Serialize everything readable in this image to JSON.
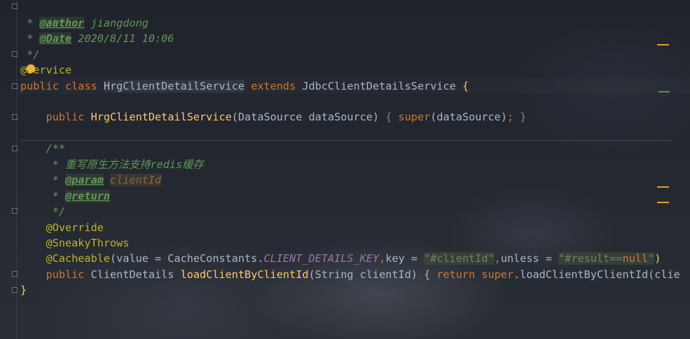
{
  "code": {
    "l1": "/**",
    "l2_star": " * ",
    "l2_tag": "@author",
    "l2_val": " jiangdong",
    "l3_star": " * ",
    "l3_tag": "@Date",
    "l3_val": " 2020/8/11 10:06",
    "l4": " */",
    "l5": "@Service",
    "l6_public": "public",
    "l6_class": " class ",
    "l6_name": "HrgClientDetailService",
    "l6_extends": " extends ",
    "l6_super": "JdbcClientDetailsService ",
    "l6_brace": "{",
    "l7_public": "    public ",
    "l7_name": "HrgClientDetailService",
    "l7_args": "(DataSource dataSource) ",
    "l7_open": "{ ",
    "l7_super": "super",
    "l7_call": "(dataSource)",
    "l7_semi": "; ",
    "l7_close": "}",
    "l8": "    /**",
    "l9": "     * 重写原生方法支持redis缓存",
    "l10_star": "     * ",
    "l10_tag": "@param",
    "l10_sp": " ",
    "l10_name": "clientId",
    "l11_star": "     * ",
    "l11_tag": "@return",
    "l12": "     */",
    "l13": "    @Override",
    "l14": "    @SneakyThrows",
    "l15_ann": "    @Cacheable",
    "l15_a": "(value = CacheConstants.",
    "l15_const": "CLIENT_DETAILS_KEY",
    "l15_comma": ",",
    "l15_b": "key = ",
    "l15_str1": "\"#clientId\"",
    "l15_comma2": ",",
    "l15_c": "unless = ",
    "l15_str2a": "\"#result==",
    "l15_null": "null",
    "l15_str2b": "\"",
    "l15_end": ")",
    "l16_public": "    public ",
    "l16_type": "ClientDetails ",
    "l16_name": "loadClientByClientId",
    "l16_args": "(String clientId) { ",
    "l16_return": "return ",
    "l16_super": "super",
    "l16_rest": ".loadClientByClientId(clie",
    "l17": "}"
  },
  "colors": {
    "keyword": "#cc7832",
    "function": "#ffc66d",
    "annotation": "#bbb529",
    "comment": "#629755",
    "constant": "#9876aa",
    "string": "#6a8759",
    "warning_marker": "#e0a020"
  },
  "icons": {
    "intention_bulb": "lightbulb-icon"
  }
}
